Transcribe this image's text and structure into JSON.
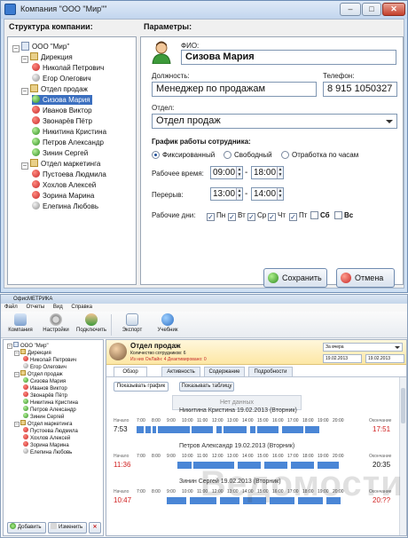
{
  "dialog": {
    "title": "Компания \"ООО \"Мир\"\"",
    "left_panel_title": "Структура компании:",
    "right_panel_title": "Параметры:",
    "fio_label": "ФИО:",
    "fio_value": "Сизова Мария",
    "position_label": "Должность:",
    "position_value": "Менеджер по  продажам",
    "phone_label": "Телефон:",
    "phone_value": "8 915 1050327",
    "dept_label": "Отдел:",
    "dept_value": "Отдел продаж",
    "schedule_title": "График работы сотрудника:",
    "schedule_options": [
      "Фиксированный",
      "Свободный",
      "Отработка по часам"
    ],
    "work_time_label": "Рабочее время:",
    "work_from": "09:00",
    "work_to": "18:00",
    "break_label": "Перерыв:",
    "break_from": "13:00",
    "break_to": "14:00",
    "workdays_label": "Рабочие дни:",
    "days": [
      {
        "label": "Пн",
        "checked": true
      },
      {
        "label": "Вт",
        "checked": true
      },
      {
        "label": "Ср",
        "checked": true
      },
      {
        "label": "Чт",
        "checked": true
      },
      {
        "label": "Пт",
        "checked": true
      },
      {
        "label": "Сб",
        "checked": false
      },
      {
        "label": "Вс",
        "checked": false
      }
    ],
    "save_label": "Сохранить",
    "cancel_label": "Отмена",
    "tree": {
      "root": "ООО \"Мир\"",
      "groups": [
        {
          "name": "Дирекция",
          "members": [
            {
              "name": "Николай Петрович",
              "status": "red"
            },
            {
              "name": "Егор Олегович",
              "status": "gray"
            }
          ]
        },
        {
          "name": "Отдел продаж",
          "members": [
            {
              "name": "Сизова Мария",
              "status": "green",
              "selected": true
            },
            {
              "name": "Иванов Виктор",
              "status": "red"
            },
            {
              "name": "Звонарёв Пётр",
              "status": "red"
            },
            {
              "name": "Никитина Кристина",
              "status": "green"
            },
            {
              "name": "Петров Александр",
              "status": "green"
            },
            {
              "name": "Зинин Сергей",
              "status": "green"
            }
          ]
        },
        {
          "name": "Отдел маркетинга",
          "members": [
            {
              "name": "Пустоева Людмила",
              "status": "red"
            },
            {
              "name": "Хохлов Алексей",
              "status": "red"
            },
            {
              "name": "Зорина Марина",
              "status": "red"
            },
            {
              "name": "Елепина Любовь",
              "status": "gray"
            }
          ]
        }
      ]
    }
  },
  "app": {
    "title": "ОфисМЕТРИКА",
    "menu": [
      "Файл",
      "Отчеты",
      "Вид",
      "Справка"
    ],
    "toolbar": [
      "Компания",
      "Настройки",
      "Подключить",
      "Экспорт",
      "Учебник"
    ],
    "add_label": "Добавить",
    "edit_label": "Изменить",
    "dept_title": "Отдел продаж",
    "staff_count": "Количество сотрудников: 6",
    "staff_status": "Из них ОнЛайн: 4  Деактивировано: 0",
    "period_select": "За вчера",
    "date_from": "19.02.2013",
    "date_to": "19.02.2013",
    "tabs": [
      "Обзор",
      "Активность",
      "Содержание",
      "Подробности"
    ],
    "view_buttons": [
      "Показывать график",
      "Показывать таблицу"
    ],
    "no_data": "Нет данных",
    "start_label": "Начало",
    "end_label": "Окончание",
    "hours": [
      "7:00",
      "8:00",
      "9:00",
      "10:00",
      "11:00",
      "12:00",
      "13:00",
      "14:00",
      "15:00",
      "16:00",
      "17:00",
      "18:00",
      "19:00",
      "20:00"
    ],
    "employees": [
      {
        "title": "Никитина Кристина 19.02.2013 (Вторник)",
        "start": "7:53",
        "end": "17:51"
      },
      {
        "title": "Петров Александр 19.02.2013 (Вторник)",
        "start": "11:36",
        "end": "20:35"
      },
      {
        "title": "Зинин Сергей 19.02.2013 (Вторник)",
        "start": "10:47",
        "end": "20:??"
      }
    ],
    "watermark": "Ведомости",
    "colors": {
      "accent": "#4a86d6",
      "late": "#d02020",
      "online": "#2e8b1f",
      "offline": "#c62828"
    }
  }
}
